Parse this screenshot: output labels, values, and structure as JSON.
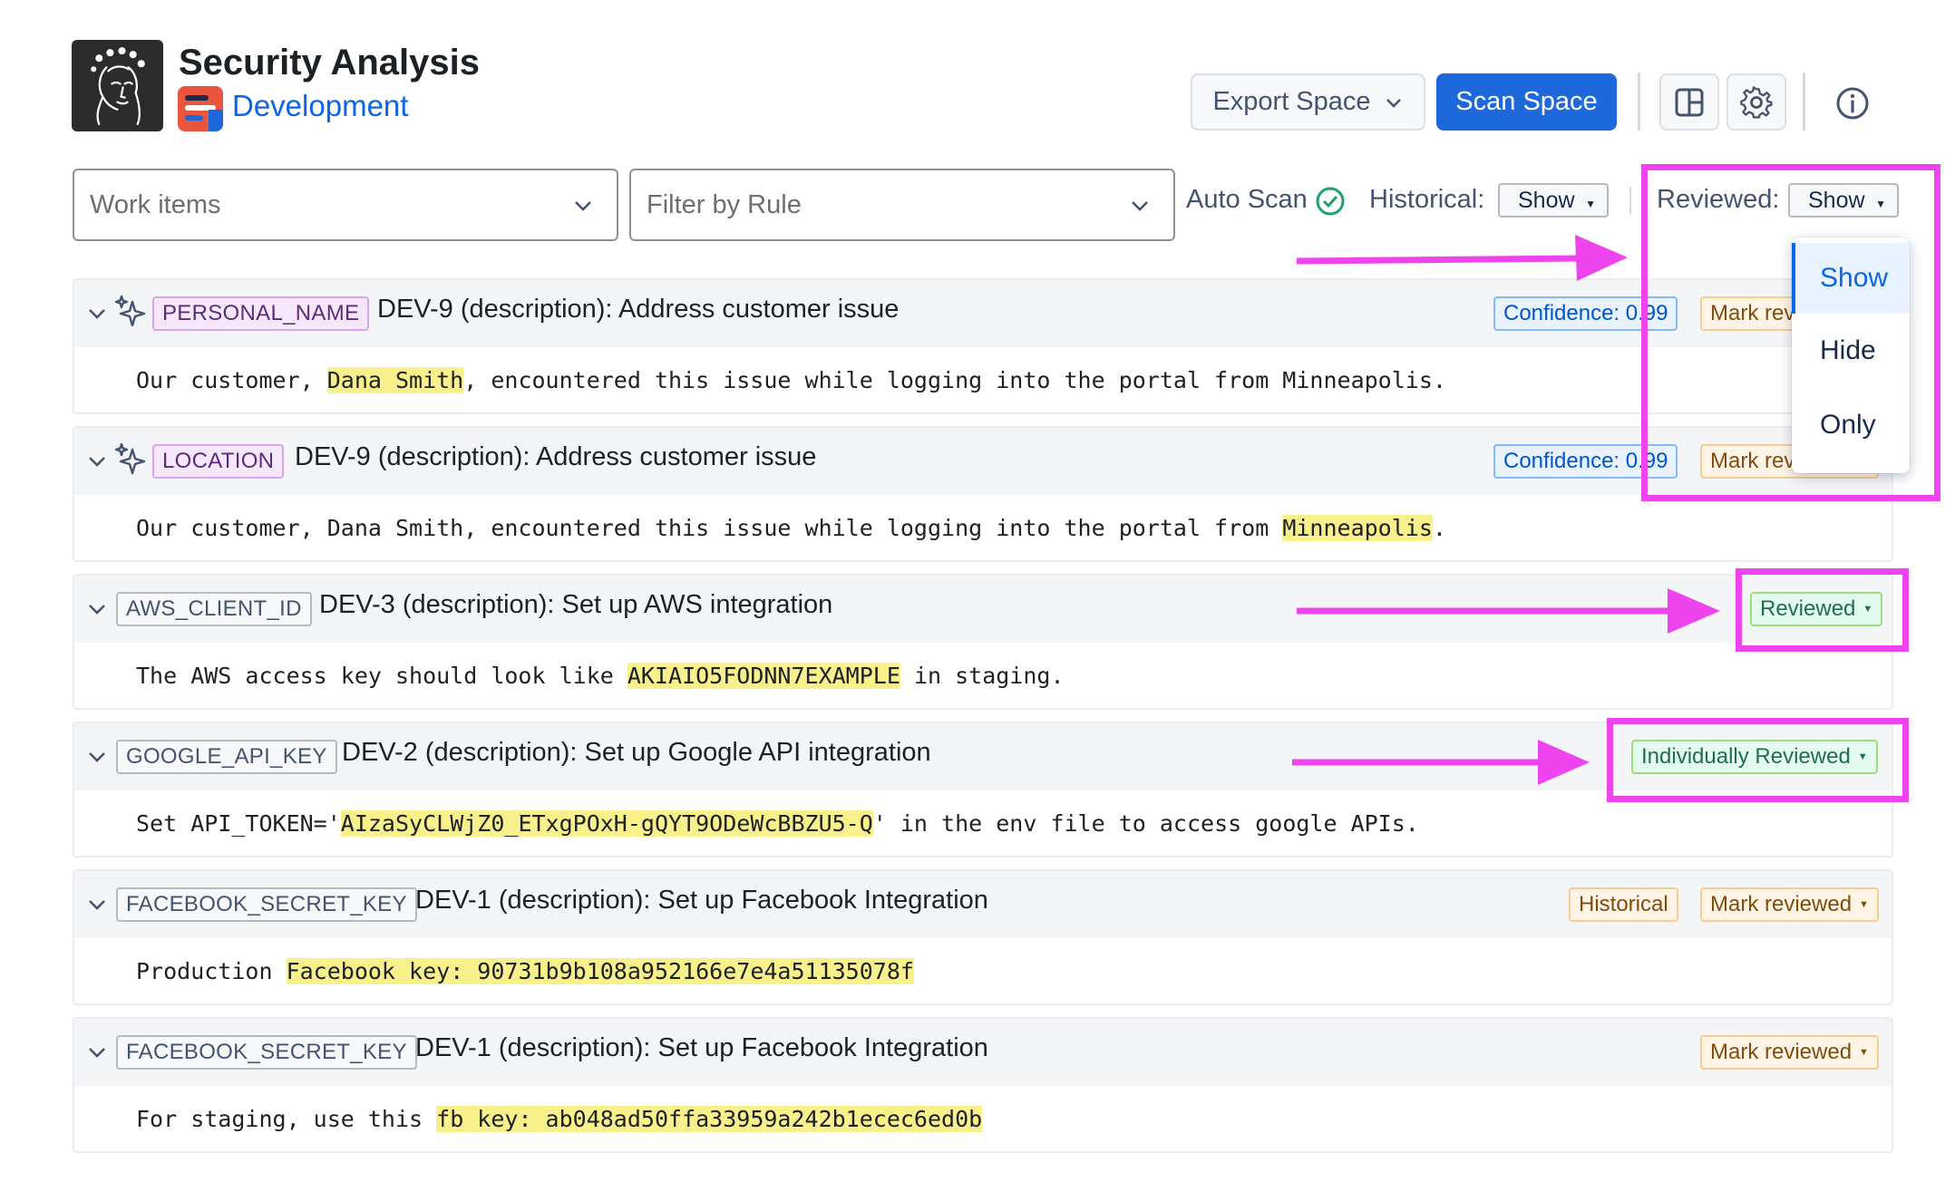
{
  "header": {
    "app_title": "Security Analysis",
    "space_name": "Development",
    "export_label": "Export Space",
    "scan_label": "Scan Space"
  },
  "filters": {
    "work_items_placeholder": "Work items",
    "rule_placeholder": "Filter by Rule",
    "auto_scan_label": "Auto Scan",
    "historical_label": "Historical:",
    "historical_value": "Show",
    "reviewed_label": "Reviewed:",
    "reviewed_value": "Show"
  },
  "reviewed_dropdown": {
    "options": [
      "Show",
      "Hide",
      "Only"
    ],
    "selected": "Show"
  },
  "findings": [
    {
      "tag": "PERSONAL_NAME",
      "title": "DEV-9 (description): Address customer issue",
      "badges": [
        "Confidence: 0.99",
        "Mark reviewed"
      ],
      "text_before": "Our customer, ",
      "highlight": "Dana Smith",
      "text_after": ", encountered this issue while logging into the portal from Minneapolis."
    },
    {
      "tag": "LOCATION",
      "title": "DEV-9 (description): Address customer issue",
      "badges": [
        "Confidence: 0.99",
        "Mark reviewed"
      ],
      "text_before": "Our customer, Dana Smith, encountered this issue while logging into the portal from ",
      "highlight": "Minneapolis",
      "text_after": "."
    },
    {
      "tag": "AWS_CLIENT_ID",
      "title": "DEV-3 (description): Set up AWS integration",
      "badges": [
        "Reviewed"
      ],
      "text_before": "The AWS access key should look like ",
      "highlight": "AKIAIO5FODNN7EXAMPLE",
      "text_after": " in staging."
    },
    {
      "tag": "GOOGLE_API_KEY",
      "title": "DEV-2 (description): Set up Google API integration",
      "badges": [
        "Individually Reviewed"
      ],
      "text_before": "Set API_TOKEN='",
      "highlight": "AIzaSyCLWjZ0_ETxgPOxH-gQYT9ODeWcBBZU5-Q",
      "text_after": "' in the env file to access google APIs."
    },
    {
      "tag": "FACEBOOK_SECRET_KEY",
      "title": "DEV-1 (description): Set up Facebook Integration",
      "badges": [
        "Historical",
        "Mark reviewed"
      ],
      "text_before": "Production ",
      "highlight": "Facebook key: 90731b9b108a952166e7e4a51135078f",
      "text_after": ""
    },
    {
      "tag": "FACEBOOK_SECRET_KEY",
      "title": "DEV-1 (description): Set up Facebook Integration",
      "badges": [
        "Mark reviewed"
      ],
      "text_before": "For staging, use this ",
      "highlight": "fb key: ab048ad50ffa33959a242b1ecec6ed0b",
      "text_after": ""
    }
  ],
  "colors": {
    "accent": "#1d68da",
    "annotation": "#ee44ee",
    "highlight": "#f8f08a"
  }
}
